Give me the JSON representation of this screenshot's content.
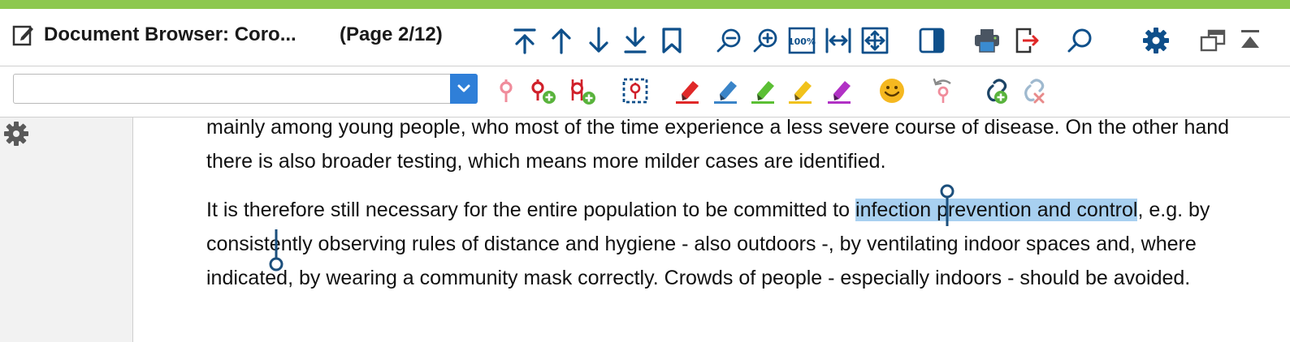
{
  "window": {
    "title": "Document Browser: Coro...",
    "page_indicator": "(Page 2/12)"
  },
  "header_icons": [
    "edit-icon",
    "go-first-page-icon",
    "previous-page-icon",
    "next-page-icon",
    "go-last-page-icon",
    "bookmark-icon",
    "zoom-out-icon",
    "zoom-in-icon",
    "zoom-100-icon",
    "fit-width-icon",
    "fit-page-icon",
    "sidebar-toggle-icon",
    "print-icon",
    "export-icon",
    "search-icon",
    "settings-icon",
    "undock-window-icon",
    "collapse-icon"
  ],
  "zoom_100_label": "100%",
  "code_combo": {
    "value": "",
    "placeholder": ""
  },
  "toolbar_icons": [
    "code-icon",
    "new-code-icon",
    "code-with-new-code-icon",
    "select-area-icon",
    "highlight-red-icon",
    "highlight-blue-icon",
    "highlight-green-icon",
    "highlight-yellow-icon",
    "highlight-purple-icon",
    "emoticon-icon",
    "undo-code-icon",
    "add-link-icon",
    "remove-link-icon"
  ],
  "colors": {
    "accent": "#8dc84e",
    "icon_blue": "#0e4f8a",
    "combo_blue": "#2f7fd8",
    "highlight": "#a8d0f0",
    "code_pink": "#f08c9b",
    "code_red": "#d0202a",
    "add_green": "#59b33c",
    "marker_red": "#e02828",
    "marker_blue": "#3a84c8",
    "marker_green": "#5bbf34",
    "marker_yellow": "#f1c21b",
    "marker_purple": "#b131c5"
  },
  "document": {
    "paragraph1": "mainly among young people, who most of the time experience a less severe course of disease. On the other hand there is also broader testing, which means more milder cases are identified.",
    "paragraph2_before": "It is therefore still necessary for the entire population to be committed to ",
    "paragraph2_selected": "infection prevention and control",
    "paragraph2_after": ", e.g. by consistently observing rules of distance and hygiene - also outdoors -, by ventilating indoor spaces and, where indicated, by wearing a community mask correctly. Crowds of people - especially indoors - should be avoided."
  }
}
